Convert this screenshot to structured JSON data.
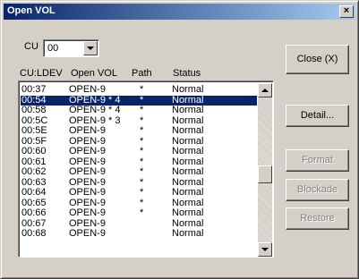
{
  "window": {
    "title": "Open VOL",
    "close_glyph": "×"
  },
  "cu_selector": {
    "label": "CU",
    "value": "00"
  },
  "list": {
    "headers": {
      "ldev": "CU:LDEV",
      "vol": "Open VOL",
      "path": "Path",
      "status": "Status"
    },
    "rows": [
      {
        "ldev": "00:37",
        "vol": "OPEN-9",
        "path": "*",
        "status": "Normal",
        "selected": false
      },
      {
        "ldev": "00:54",
        "vol": "OPEN-9 * 4",
        "path": "*",
        "status": "Normal",
        "selected": true
      },
      {
        "ldev": "00:58",
        "vol": "OPEN-9 * 4",
        "path": "*",
        "status": "Normal",
        "selected": false
      },
      {
        "ldev": "00:5C",
        "vol": "OPEN-9 * 3",
        "path": "*",
        "status": "Normal",
        "selected": false
      },
      {
        "ldev": "00:5E",
        "vol": "OPEN-9",
        "path": "*",
        "status": "Normal",
        "selected": false
      },
      {
        "ldev": "00:5F",
        "vol": "OPEN-9",
        "path": "*",
        "status": "Normal",
        "selected": false
      },
      {
        "ldev": "00:60",
        "vol": "OPEN-9",
        "path": "*",
        "status": "Normal",
        "selected": false
      },
      {
        "ldev": "00:61",
        "vol": "OPEN-9",
        "path": "*",
        "status": "Normal",
        "selected": false
      },
      {
        "ldev": "00:62",
        "vol": "OPEN-9",
        "path": "*",
        "status": "Normal",
        "selected": false
      },
      {
        "ldev": "00:63",
        "vol": "OPEN-9",
        "path": "*",
        "status": "Normal",
        "selected": false
      },
      {
        "ldev": "00:64",
        "vol": "OPEN-9",
        "path": "*",
        "status": "Normal",
        "selected": false
      },
      {
        "ldev": "00:65",
        "vol": "OPEN-9",
        "path": "*",
        "status": "Normal",
        "selected": false
      },
      {
        "ldev": "00:66",
        "vol": "OPEN-9",
        "path": "*",
        "status": "Normal",
        "selected": false
      },
      {
        "ldev": "00:67",
        "vol": "OPEN-9",
        "path": "",
        "status": "Normal",
        "selected": false
      },
      {
        "ldev": "00:68",
        "vol": "OPEN-9",
        "path": "",
        "status": "Normal",
        "selected": false
      }
    ]
  },
  "buttons": {
    "close": "Close (X)",
    "detail": "Detail...",
    "format": "Format",
    "blockade": "Blockade",
    "restore": "Restore"
  },
  "colors": {
    "title_gradient_start": "#0a246a",
    "title_gradient_end": "#a6caf0",
    "selection": "#0a246a",
    "face": "#d4d0c8"
  }
}
